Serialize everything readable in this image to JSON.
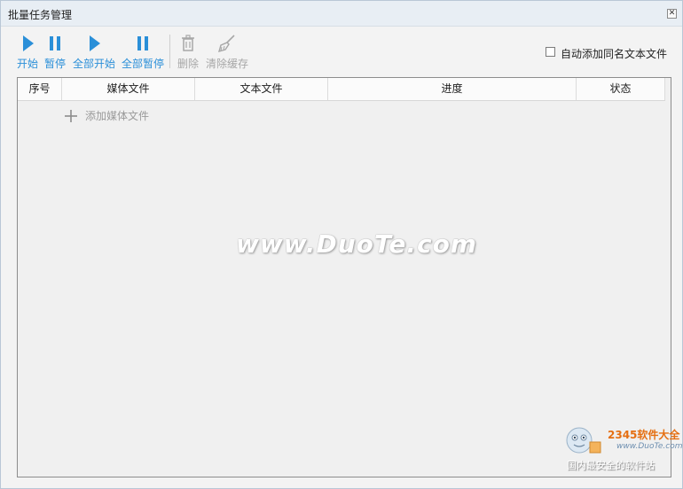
{
  "window": {
    "title": "批量任务管理",
    "close_icon": "close-icon"
  },
  "toolbar": {
    "items": [
      {
        "label": "开始",
        "icon": "play-icon",
        "enabled": true
      },
      {
        "label": "暂停",
        "icon": "pause-icon",
        "enabled": true
      },
      {
        "label": "全部开始",
        "icon": "play-icon",
        "enabled": true
      },
      {
        "label": "全部暂停",
        "icon": "pause-icon",
        "enabled": true
      },
      {
        "label": "删除",
        "icon": "trash-icon",
        "enabled": false
      },
      {
        "label": "清除缓存",
        "icon": "broom-icon",
        "enabled": false
      }
    ],
    "auto_add_checkbox": {
      "label": "自动添加同名文本文件",
      "checked": false
    }
  },
  "table": {
    "columns": [
      "序号",
      "媒体文件",
      "文本文件",
      "进度",
      "状态"
    ],
    "add_row_label": "添加媒体文件"
  },
  "watermark": {
    "text": "www.DuoTe.com"
  },
  "corner_logo": {
    "brand": "2345软件大全",
    "url": "www.DuoTe.com",
    "slogan": "国内最安全的软件站"
  },
  "colors": {
    "accent": "#2a8fd8",
    "disabled": "#a7a7a7",
    "titlebar_bg": "#e8eef4"
  }
}
